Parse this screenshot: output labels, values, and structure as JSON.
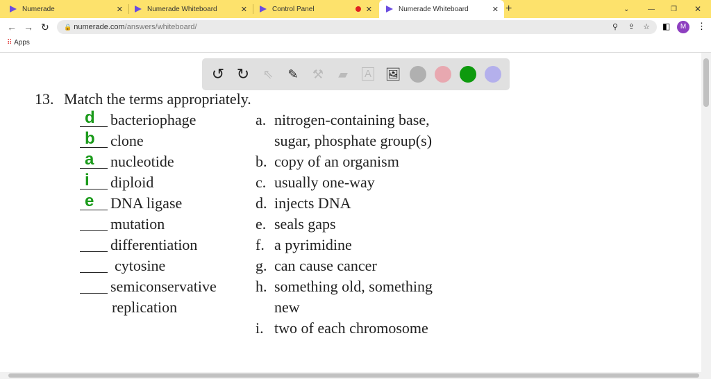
{
  "browser": {
    "tabs": [
      {
        "label": "Numerade"
      },
      {
        "label": "Numerade Whiteboard"
      },
      {
        "label": "Control Panel"
      },
      {
        "label": "Numerade Whiteboard",
        "active": true
      }
    ],
    "url_host": "numerade.com",
    "url_path": "/answers/whiteboard/",
    "bookmarks": {
      "apps": "Apps"
    },
    "profile": "M"
  },
  "toolbar": {
    "tools": [
      "undo-icon",
      "redo-icon",
      "pointer-icon",
      "pen-icon",
      "tools-icon",
      "eraser-icon",
      "text-icon",
      "image-icon"
    ],
    "colors": [
      "#b0b0b0",
      "#e8a8b0",
      "#0e9a0e",
      "#b4b0ec"
    ]
  },
  "question": {
    "number": "13.",
    "title": "Match the terms appropriately.",
    "terms": [
      {
        "answer": "d",
        "term": "bacteriophage"
      },
      {
        "answer": "b",
        "term": "clone"
      },
      {
        "answer": "a",
        "term": "nucleotide"
      },
      {
        "answer": "i",
        "term": "diploid"
      },
      {
        "answer": "e",
        "term": "DNA ligase"
      },
      {
        "answer": "",
        "term": "mutation"
      },
      {
        "answer": "",
        "term": "differentiation"
      },
      {
        "answer": "",
        "term": "cytosine"
      },
      {
        "answer": "",
        "term": "semiconservative"
      },
      {
        "answer": "",
        "term": "replication"
      }
    ],
    "definitions": [
      {
        "letter": "a.",
        "text": "nitrogen-containing base,"
      },
      {
        "letter": "",
        "text": "sugar, phosphate group(s)"
      },
      {
        "letter": "b.",
        "text": "copy of an organism"
      },
      {
        "letter": "c.",
        "text": "usually one-way"
      },
      {
        "letter": "d.",
        "text": "injects DNA"
      },
      {
        "letter": "e.",
        "text": "seals gaps"
      },
      {
        "letter": "f.",
        "text": "a pyrimidine"
      },
      {
        "letter": "g.",
        "text": "can cause cancer"
      },
      {
        "letter": "h.",
        "text": "something old, something"
      },
      {
        "letter": "",
        "text": "new"
      },
      {
        "letter": "i.",
        "text": "two of each chromosome"
      }
    ]
  }
}
